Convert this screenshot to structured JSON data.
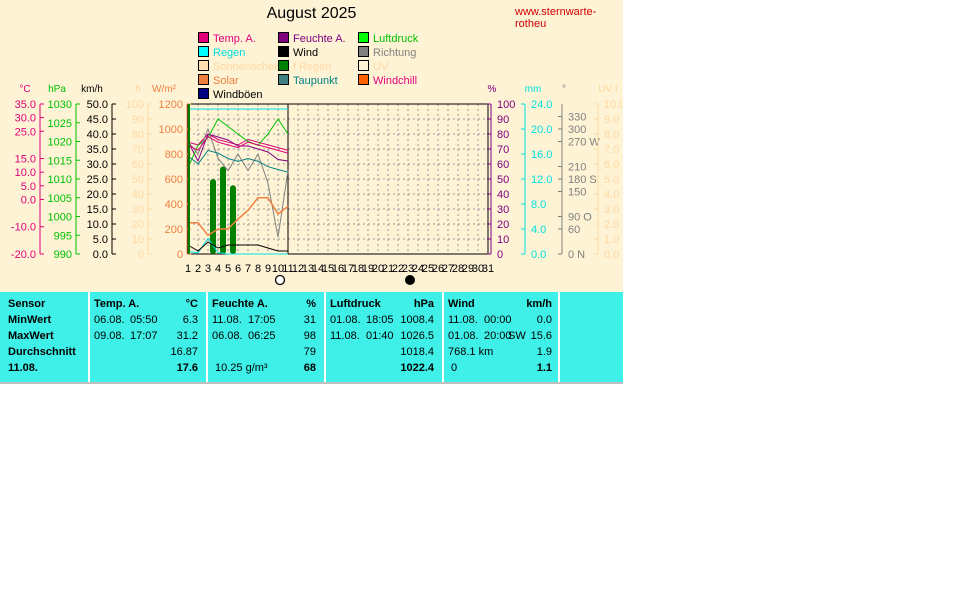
{
  "title": "August 2025",
  "url_text": "www.sternwarte-rotheu",
  "legend": [
    {
      "label": "Temp. A.",
      "color": "#e0007a",
      "swatch": "#e0007a"
    },
    {
      "label": "Feuchte A.",
      "color": "#800080",
      "swatch": "#800080"
    },
    {
      "label": "Luftdruck",
      "color": "#00c000",
      "swatch": "#00ff00"
    },
    {
      "label": "Regen",
      "color": "#00e0e0",
      "swatch": "#00ffff"
    },
    {
      "label": "Wind",
      "color": "#000000",
      "swatch": "#000000"
    },
    {
      "label": "Richtung",
      "color": "#808080",
      "swatch": "#808080"
    },
    {
      "label": "Sonnenschein",
      "color": "#ffd8a0",
      "swatch": "#ffe0b0"
    },
    {
      "label": "f Regen",
      "color": "#ffd8a0",
      "swatch": "#008000"
    },
    {
      "label": "UV",
      "color": "#ffd8a0",
      "swatch": "#fff3d6"
    },
    {
      "label": "Solar",
      "color": "#f08040",
      "swatch": "#f08040"
    },
    {
      "label": "Taupunkt",
      "color": "#008080",
      "swatch": "#408080"
    },
    {
      "label": "Windchill",
      "color": "#e0007a",
      "swatch": "#ff6000"
    },
    {
      "label": "Windböen",
      "color": "#000000",
      "swatch": "#000080"
    }
  ],
  "axes": {
    "temp": {
      "unit": "°C",
      "ticks": [
        "35.0",
        "30.0",
        "25.0",
        "15.0",
        "10.0",
        "5.0",
        "0.0",
        "-10.0",
        "-20.0"
      ],
      "color": "#e0007a"
    },
    "hpa": {
      "unit": "hPa",
      "ticks": [
        "1030",
        "1025",
        "1020",
        "1015",
        "1010",
        "1005",
        "1000",
        "995",
        "990"
      ],
      "color": "#00c000"
    },
    "kmh": {
      "unit": "km/h",
      "ticks": [
        "50.0",
        "45.0",
        "40.0",
        "35.0",
        "30.0",
        "25.0",
        "20.0",
        "15.0",
        "10.0",
        "5.0",
        "0.0"
      ],
      "color": "#000000"
    },
    "h": {
      "unit": "h",
      "ticks": [
        "100",
        "90",
        "80",
        "70",
        "60",
        "50",
        "40",
        "30",
        "20",
        "10",
        "0"
      ],
      "color": "#ffd8a0"
    },
    "wm2": {
      "unit": "W/m²",
      "ticks": [
        "1200",
        "1000",
        "800",
        "600",
        "400",
        "200",
        "0"
      ],
      "color": "#f08040"
    },
    "pct": {
      "unit": "%",
      "ticks": [
        "100",
        "90",
        "80",
        "70",
        "60",
        "50",
        "40",
        "30",
        "20",
        "10",
        "0"
      ],
      "color": "#800080"
    },
    "mm": {
      "unit": "mm",
      "ticks": [
        "24.0",
        "20.0",
        "16.0",
        "12.0",
        "8.0",
        "4.0",
        "0.0"
      ],
      "color": "#00e0e0"
    },
    "deg": {
      "unit": "°",
      "ticks": [
        "330",
        "300",
        "270 W",
        "210",
        "180 S",
        "150",
        "90  O",
        "60",
        "0   N"
      ],
      "color": "#808080"
    },
    "uv": {
      "unit": "UV I",
      "ticks": [
        "10.0",
        "9.0",
        "8.0",
        "7.0",
        "6.0",
        "5.0",
        "4.0",
        "3.0",
        "2.0",
        "1.0",
        "0.0"
      ],
      "color": "#ffd8a0"
    }
  },
  "x_labels": [
    "1",
    "2",
    "3",
    "4",
    "5",
    "6",
    "7",
    "8",
    "9",
    "10",
    "11",
    "12",
    "13",
    "14",
    "15",
    "16",
    "17",
    "18",
    "19",
    "20",
    "21",
    "22",
    "23",
    "24",
    "25",
    "26",
    "27",
    "28",
    "29",
    "30",
    "31"
  ],
  "moon_phases": [
    {
      "day": 10,
      "phase": "full-moon"
    },
    {
      "day": 23,
      "phase": "new-moon"
    }
  ],
  "chart_data": {
    "type": "line",
    "title": "August 2025",
    "x": [
      1,
      2,
      3,
      4,
      5,
      6,
      7,
      8,
      9,
      10,
      11
    ],
    "xlim": [
      1,
      31
    ],
    "series": [
      {
        "name": "Temp. A.",
        "axis": "temp",
        "color": "#e0007a",
        "values": [
          21,
          20,
          24,
          22,
          21,
          20,
          22,
          21,
          20,
          19,
          18
        ]
      },
      {
        "name": "Feuchte A.",
        "axis": "pct",
        "color": "#800080",
        "values": [
          75,
          62,
          80,
          78,
          76,
          72,
          72,
          70,
          68,
          63,
          62
        ]
      },
      {
        "name": "Luftdruck",
        "axis": "hpa",
        "color": "#00c000",
        "values": [
          1013,
          1019,
          1021,
          1026,
          1024,
          1022,
          1020,
          1019,
          1022,
          1026,
          1022
        ]
      },
      {
        "name": "Regen",
        "axis": "mm",
        "color": "#00e0e0",
        "values": [
          0.4,
          0.2,
          2.5,
          0.2,
          0.0,
          0.0,
          0.0,
          0.0,
          0.0,
          0.0,
          0.0
        ]
      },
      {
        "name": "Wind",
        "axis": "kmh",
        "color": "#000000",
        "values": [
          3,
          1,
          4,
          2,
          3,
          3,
          3,
          3,
          2,
          1,
          1
        ]
      },
      {
        "name": "Richtung",
        "axis": "deg",
        "color": "#808080",
        "values": [
          270,
          240,
          300,
          230,
          200,
          240,
          200,
          240,
          170,
          40,
          200
        ]
      },
      {
        "name": "Solar",
        "axis": "wm2",
        "color": "#f08040",
        "values": [
          250,
          250,
          150,
          200,
          200,
          280,
          350,
          450,
          450,
          320,
          380
        ]
      },
      {
        "name": "Taupunkt",
        "axis": "temp",
        "color": "#008080",
        "values": [
          16,
          13,
          18,
          17,
          15,
          14,
          15,
          14,
          12,
          11,
          10
        ]
      },
      {
        "name": "Windchill",
        "axis": "temp",
        "color": "#e0007a",
        "values": [
          20,
          18,
          23,
          21,
          20,
          19,
          21,
          20,
          19,
          18,
          17
        ]
      }
    ],
    "regen_bars": [
      {
        "day": 3,
        "value": 12
      },
      {
        "day": 4,
        "value": 14
      },
      {
        "day": 5,
        "value": 11
      }
    ],
    "regen_max_line": 23.2
  },
  "table": {
    "row_headers": [
      "Sensor",
      "MinWert",
      "MaxWert",
      "Durchschnitt",
      "11.08."
    ],
    "temp": {
      "header": "Temp. A.",
      "unit": "°C",
      "rows": [
        {
          "date": "06.08.",
          "time": "05:50",
          "value": "6.3"
        },
        {
          "date": "09.08.",
          "time": "17:07",
          "value": "31.2"
        },
        {
          "date": "",
          "time": "",
          "value": "16.87"
        },
        {
          "date": "",
          "time": "",
          "value": "17.6"
        }
      ]
    },
    "feuchte": {
      "header": "Feuchte A.",
      "unit": "%",
      "rows": [
        {
          "date": "11.08.",
          "time": "17:05",
          "value": "31"
        },
        {
          "date": "06.08.",
          "time": "06:25",
          "value": "98"
        },
        {
          "date": "",
          "time": "",
          "value": "79"
        },
        {
          "date": "10.25 g/m³",
          "time": "",
          "value": "68"
        }
      ]
    },
    "luftdruck": {
      "header": "Luftdruck",
      "unit": "hPa",
      "rows": [
        {
          "date": "01.08.",
          "time": "18:05",
          "value": "1008.4"
        },
        {
          "date": "11.08.",
          "time": "01:40",
          "value": "1026.5"
        },
        {
          "date": "",
          "time": "",
          "value": "1018.4"
        },
        {
          "date": "",
          "time": "",
          "value": "1022.4"
        }
      ]
    },
    "wind": {
      "header": "Wind",
      "unit": "km/h",
      "rows": [
        {
          "date": "11.08.",
          "time": "00:00",
          "value": "0.0"
        },
        {
          "date": "01.08.",
          "time": "20:00",
          "dir": "SW",
          "value": "15.6"
        },
        {
          "date": "768.1 km",
          "time": "",
          "value": "1.9"
        },
        {
          "date": "0",
          "time": "",
          "value": "1.1"
        }
      ]
    }
  }
}
